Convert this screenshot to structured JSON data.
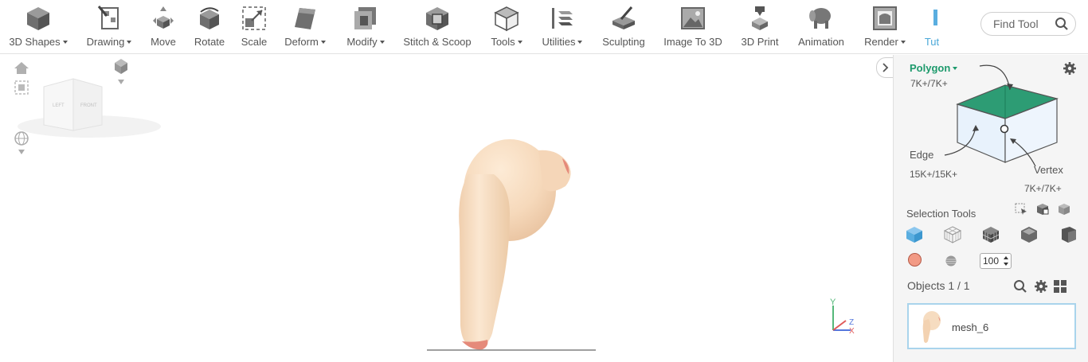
{
  "toolbar": {
    "items": [
      {
        "label": "3D Shapes",
        "dropdown": true,
        "icon": "cube-icon"
      },
      {
        "label": "Drawing",
        "dropdown": true,
        "icon": "drawing-icon"
      },
      {
        "label": "Move",
        "dropdown": false,
        "icon": "move-icon"
      },
      {
        "label": "Rotate",
        "dropdown": false,
        "icon": "rotate-icon"
      },
      {
        "label": "Scale",
        "dropdown": false,
        "icon": "scale-icon"
      },
      {
        "label": "Deform",
        "dropdown": true,
        "icon": "deform-icon"
      },
      {
        "label": "Modify",
        "dropdown": true,
        "icon": "modify-icon"
      },
      {
        "label": "Stitch & Scoop",
        "dropdown": false,
        "icon": "stitch-scoop-icon"
      },
      {
        "label": "Tools",
        "dropdown": true,
        "icon": "tools-icon"
      },
      {
        "label": "Utilities",
        "dropdown": true,
        "icon": "utilities-icon"
      },
      {
        "label": "Sculpting",
        "dropdown": false,
        "icon": "sculpting-icon"
      },
      {
        "label": "Image To 3D",
        "dropdown": false,
        "icon": "image-to-3d-icon"
      },
      {
        "label": "3D Print",
        "dropdown": false,
        "icon": "3d-print-icon"
      },
      {
        "label": "Animation",
        "dropdown": false,
        "icon": "animation-icon"
      },
      {
        "label": "Render",
        "dropdown": true,
        "icon": "render-icon"
      },
      {
        "label": "Tut",
        "dropdown": false,
        "icon": "tutorial-icon"
      }
    ],
    "find_tool": "Find Tool"
  },
  "viewport": {
    "view_cube_left": "LEFT",
    "view_cube_front": "FRONT",
    "axis_y": "Y",
    "axis_z": "Z",
    "axis_x": "X",
    "model_color": "#f6dcc0"
  },
  "panel": {
    "mode": "Polygon",
    "polygon_count": "7K+/7K+",
    "edge_label": "Edge",
    "edge_count": "15K+/15K+",
    "vertex_label": "Vertex",
    "vertex_count": "7K+/7K+",
    "selection_tools": "Selection Tools",
    "brush_size": "100",
    "objects_title": "Objects 1 / 1",
    "object_name": "mesh_6",
    "accent": "#1d9a6c",
    "selection_blue": "#5aaee0"
  }
}
